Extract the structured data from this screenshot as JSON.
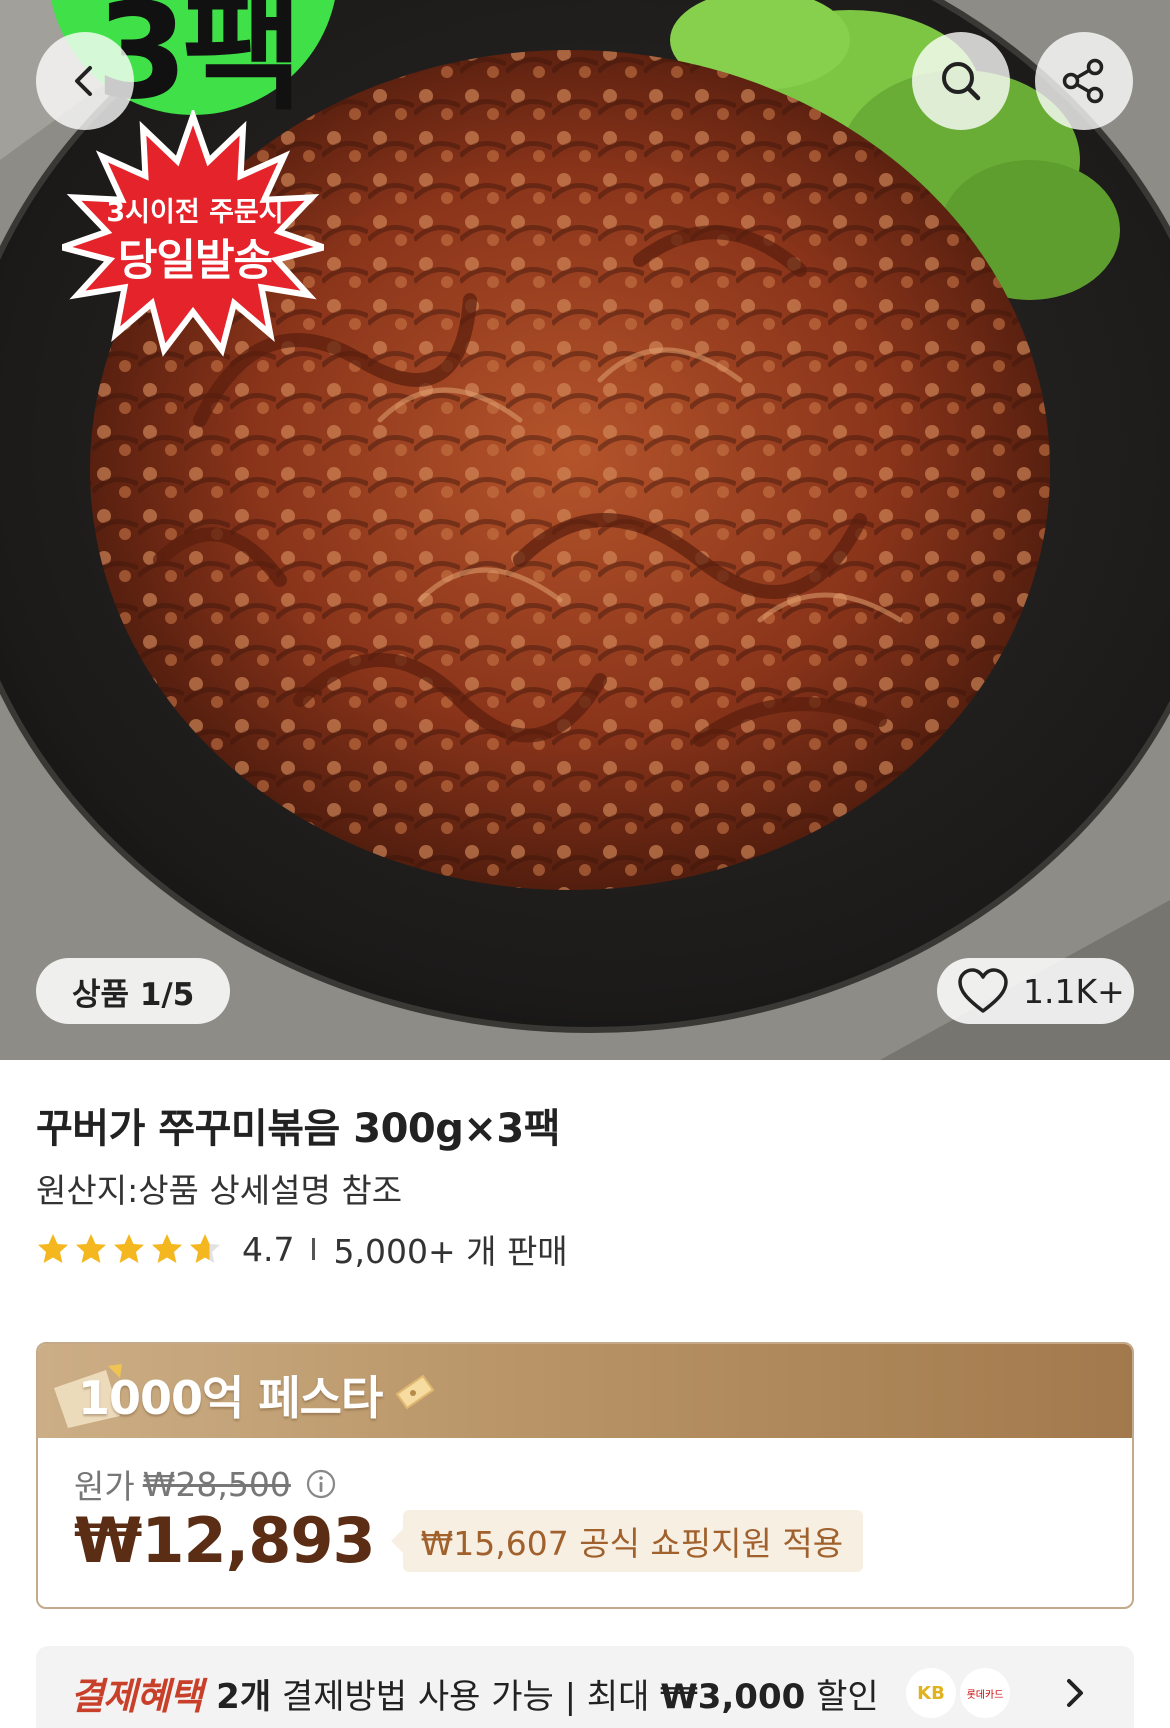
{
  "hero": {
    "promo_pack": "3팩",
    "burst_top": "3시이전 주문시",
    "burst_main": "당일발송",
    "image_counter": "상품 1/5",
    "like_count": "1.1K+"
  },
  "icons": {
    "back": "chevron-left-icon",
    "search": "search-icon",
    "share": "share-icon",
    "like": "heart-icon",
    "info": "info-icon",
    "chevron": "chevron-right-icon"
  },
  "product": {
    "title": "꾸버가 쭈꾸미볶음 300g×3팩",
    "origin": "원산지:상품 상세설명 참조",
    "rating": "4.7",
    "rating_fraction": 0.94,
    "sold": "5,000+ 개 판매"
  },
  "price": {
    "banner": "1000억 페스타",
    "original_label": "원가",
    "original_price": "₩28,500",
    "sale_price": "₩12,893",
    "support_tag": "₩15,607 공식 쇼핑지원 적용"
  },
  "payment": {
    "label": "결제혜택",
    "count": "2개",
    "text": "결제방법 사용 가능 | 최대",
    "max_amount": "₩3,000",
    "suffix": "할인",
    "card_kb": "KB",
    "card_lotte": "롯데카드"
  },
  "colors": {
    "star": "#f5b720",
    "sale_price": "#5a2d14",
    "support_tag_text": "#a0612d",
    "pay_label": "#c8402a",
    "promo_green": "#3fe048",
    "burst_red": "#e4232a"
  }
}
